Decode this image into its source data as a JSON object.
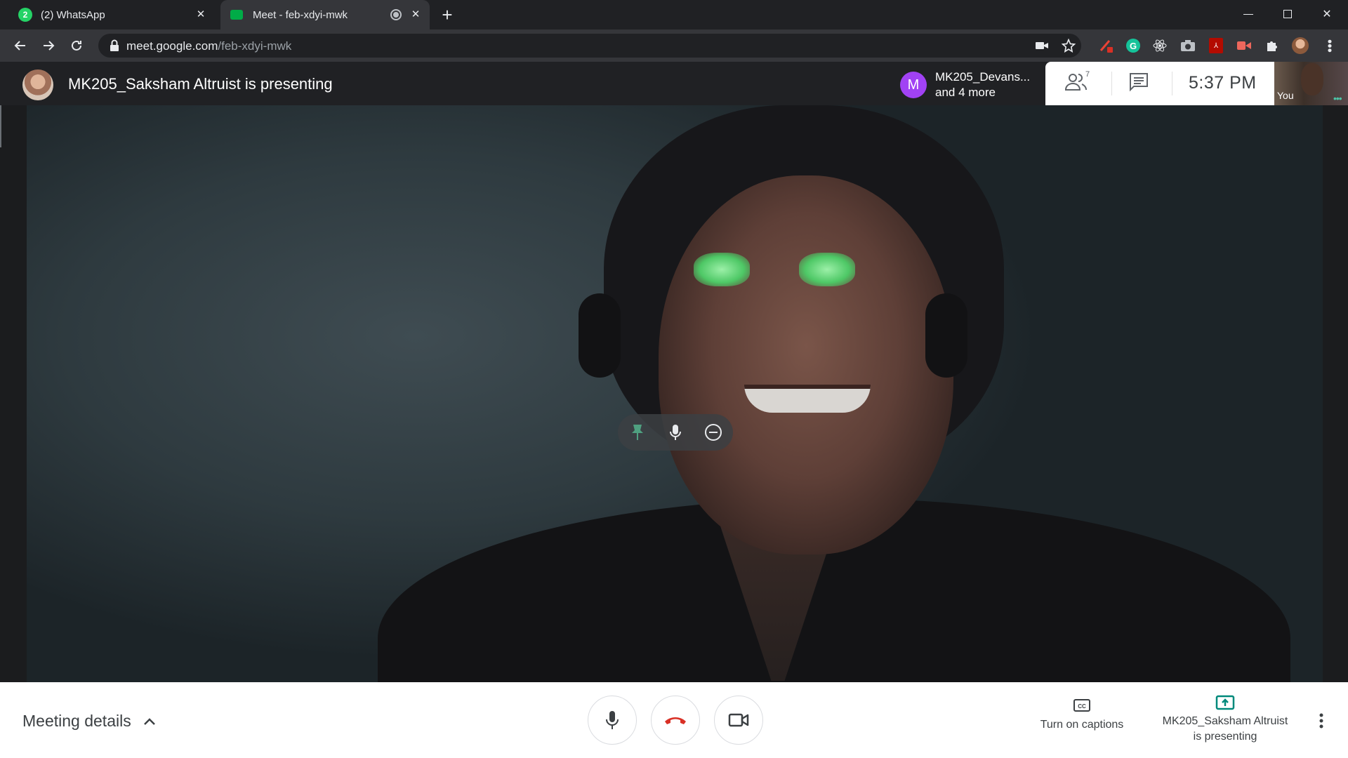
{
  "browser": {
    "tabs": [
      {
        "label": "(2) WhatsApp",
        "badge": "2",
        "active": false
      },
      {
        "label": "Meet - feb-xdyi-mwk",
        "active": true
      }
    ],
    "new_tab_symbol": "+",
    "url_host": "meet.google.com",
    "url_path": "/feb-xdyi-mwk"
  },
  "meet": {
    "presenting_title": "MK205_Saksham Altruist is presenting",
    "others": {
      "avatar_letter": "M",
      "line1": "MK205_Devans...",
      "line2": "and 4 more"
    },
    "people_count": "7",
    "time": "5:37  PM",
    "self_label": "You",
    "self_more": "•••",
    "bottom": {
      "meeting_details": "Meeting details",
      "captions_label": "Turn on captions",
      "present_label_line1": "MK205_Saksham Altruist",
      "present_label_line2": "is presenting"
    }
  },
  "colors": {
    "hangup_red": "#d93025",
    "present_green": "#00897b",
    "pin_green": "#4fa080"
  }
}
